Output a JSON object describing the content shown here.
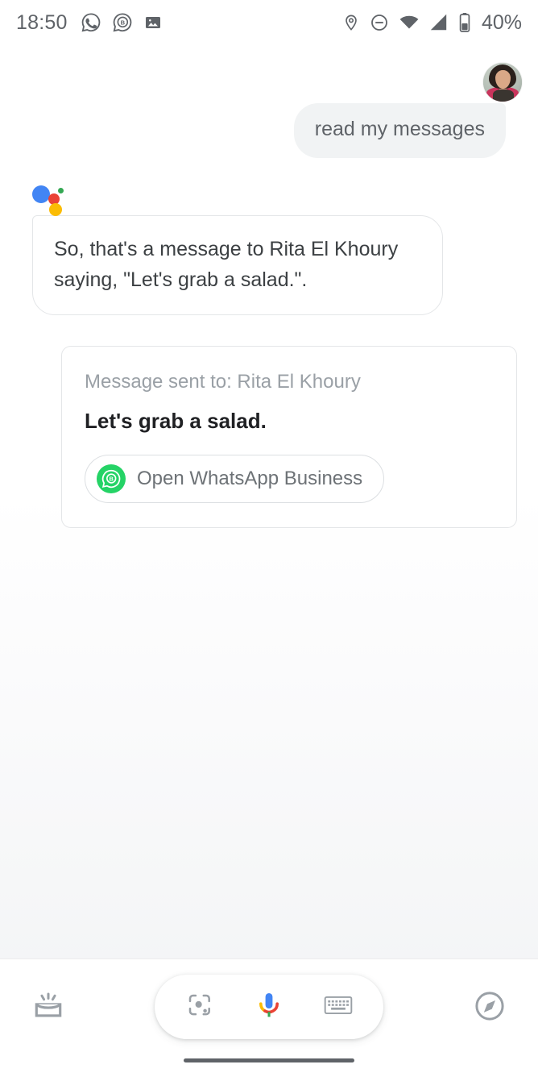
{
  "status_bar": {
    "time": "18:50",
    "battery_percent": "40%",
    "left_icons": [
      "whatsapp-icon",
      "whatsapp-business-icon",
      "photo-icon"
    ],
    "right_icons": [
      "location-pin-icon",
      "do-not-disturb-icon",
      "wifi-icon",
      "cellular-signal-icon",
      "battery-icon"
    ]
  },
  "conversation": {
    "user": {
      "avatar_name": "user-avatar",
      "query": "read my messages"
    },
    "assistant": {
      "logo_name": "google-assistant-logo",
      "response": "So, that's a message to Rita El Khoury saying, \"Let's grab a salad.\".",
      "card": {
        "subtitle": "Message sent to: Rita El Khoury",
        "message": "Let's grab a salad.",
        "action_label": "Open WhatsApp Business",
        "action_icon": "whatsapp-business-icon"
      }
    }
  },
  "bottom_bar": {
    "snapshot_icon": "snapshot-icon",
    "lens_icon": "google-lens-icon",
    "mic_icon": "google-mic-icon",
    "keyboard_icon": "keyboard-icon",
    "explore_icon": "explore-compass-icon"
  },
  "colors": {
    "assistant_blue": "#4285f4",
    "assistant_red": "#ea4335",
    "assistant_yellow": "#fbbc04",
    "assistant_green": "#34a853",
    "whatsapp_green": "#25d366",
    "bubble_grey": "#f1f3f4",
    "text_primary": "#202124",
    "text_secondary": "#5f6368",
    "text_muted": "#9aa0a6"
  }
}
